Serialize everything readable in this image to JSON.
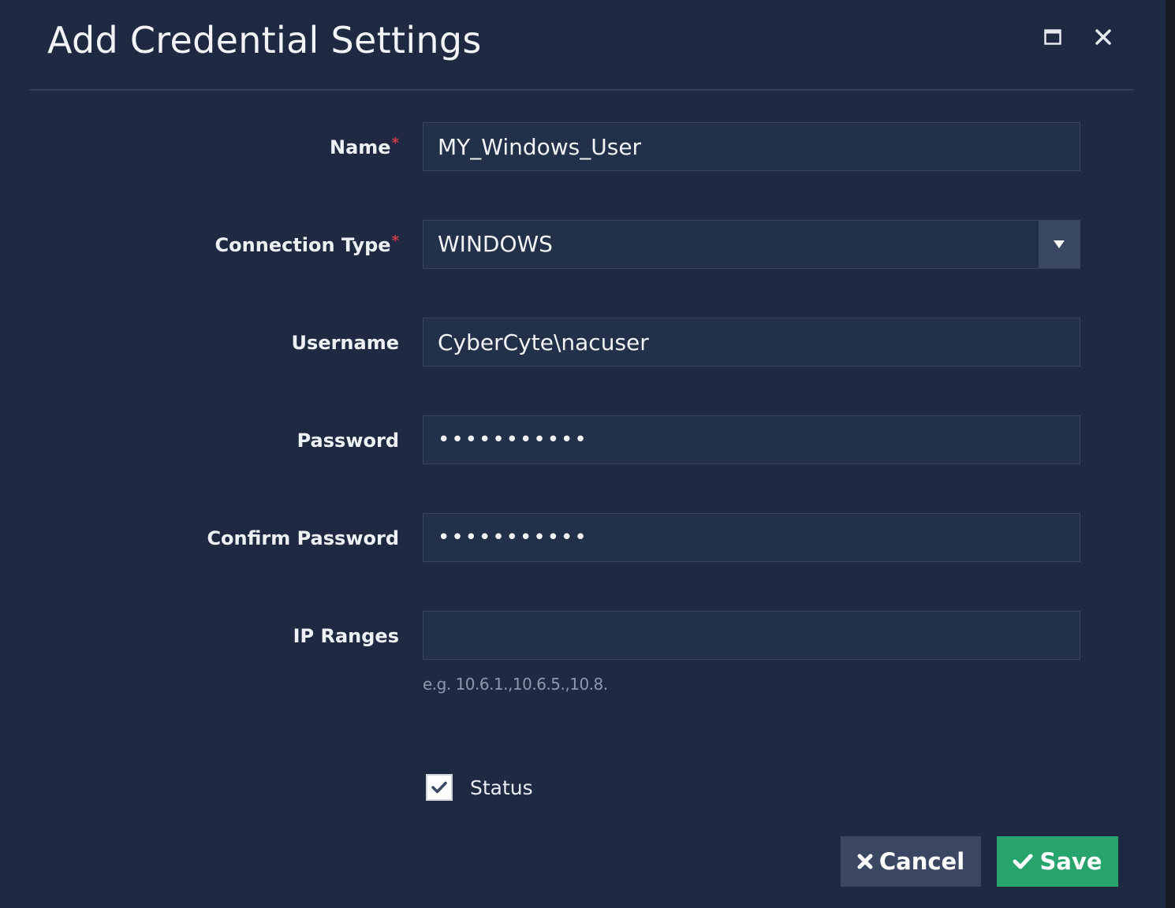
{
  "dialog": {
    "title": "Add Credential Settings",
    "maximize_icon": "maximize-icon",
    "close_icon": "close-icon"
  },
  "form": {
    "name": {
      "label": "Name",
      "required_mark": "*",
      "value": "MY_Windows_User"
    },
    "connection_type": {
      "label": "Connection Type",
      "required_mark": "*",
      "value": "WINDOWS",
      "dropdown_icon": "caret-down-icon"
    },
    "username": {
      "label": "Username",
      "value": "CyberCyte\\nacuser"
    },
    "password": {
      "label": "Password",
      "value": "•••••••••••"
    },
    "confirm_password": {
      "label": "Confirm Password",
      "value": "•••••••••••"
    },
    "ip_ranges": {
      "label": "IP Ranges",
      "value": "",
      "hint": "e.g. 10.6.1.,10.6.5.,10.8."
    },
    "status": {
      "label": "Status",
      "checked": true
    }
  },
  "buttons": {
    "cancel_label": "Cancel",
    "save_label": "Save"
  },
  "colors": {
    "background": "#1f2942",
    "input_background": "#233049",
    "required": "#d23b4a",
    "save": "#27a36c",
    "cancel": "#3b4762"
  }
}
